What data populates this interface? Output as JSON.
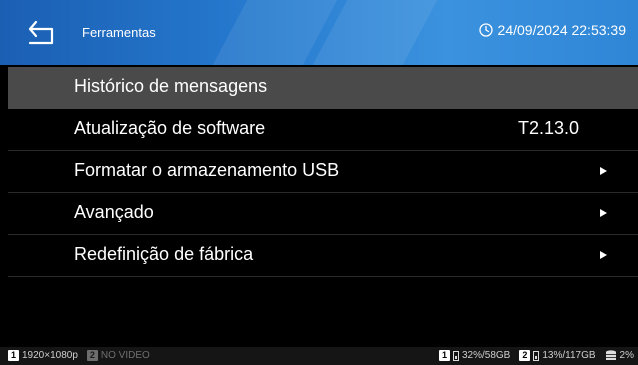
{
  "header": {
    "title": "Ferramentas",
    "datetime": "24/09/2024 22:53:39"
  },
  "menu": {
    "items": [
      {
        "label": "Histórico de mensagens",
        "value": "",
        "arrow": false,
        "selected": true
      },
      {
        "label": "Atualização de software",
        "value": "T2.13.0",
        "arrow": false,
        "selected": false
      },
      {
        "label": "Formatar o armazenamento USB",
        "value": "",
        "arrow": true,
        "selected": false
      },
      {
        "label": "Avançado",
        "value": "",
        "arrow": true,
        "selected": false
      },
      {
        "label": "Redefinição de fábrica",
        "value": "",
        "arrow": true,
        "selected": false
      }
    ]
  },
  "status": {
    "channel1_num": "1",
    "channel1_text": "1920×1080p",
    "channel2_num": "2",
    "channel2_text": "NO VIDEO",
    "usb1_num": "1",
    "usb1_text": "32%/58GB",
    "usb2_num": "2",
    "usb2_text": "13%/117GB",
    "storage_text": "2%"
  },
  "colors": {
    "header_accent": "#2477cc",
    "selected_row": "#4a4a4a",
    "background": "#000000"
  },
  "icons": {
    "back": "back-arrow-icon",
    "clock": "clock-icon",
    "arrow": "chevron-right-icon",
    "usb": "usb-drive-icon",
    "storage": "database-icon"
  }
}
